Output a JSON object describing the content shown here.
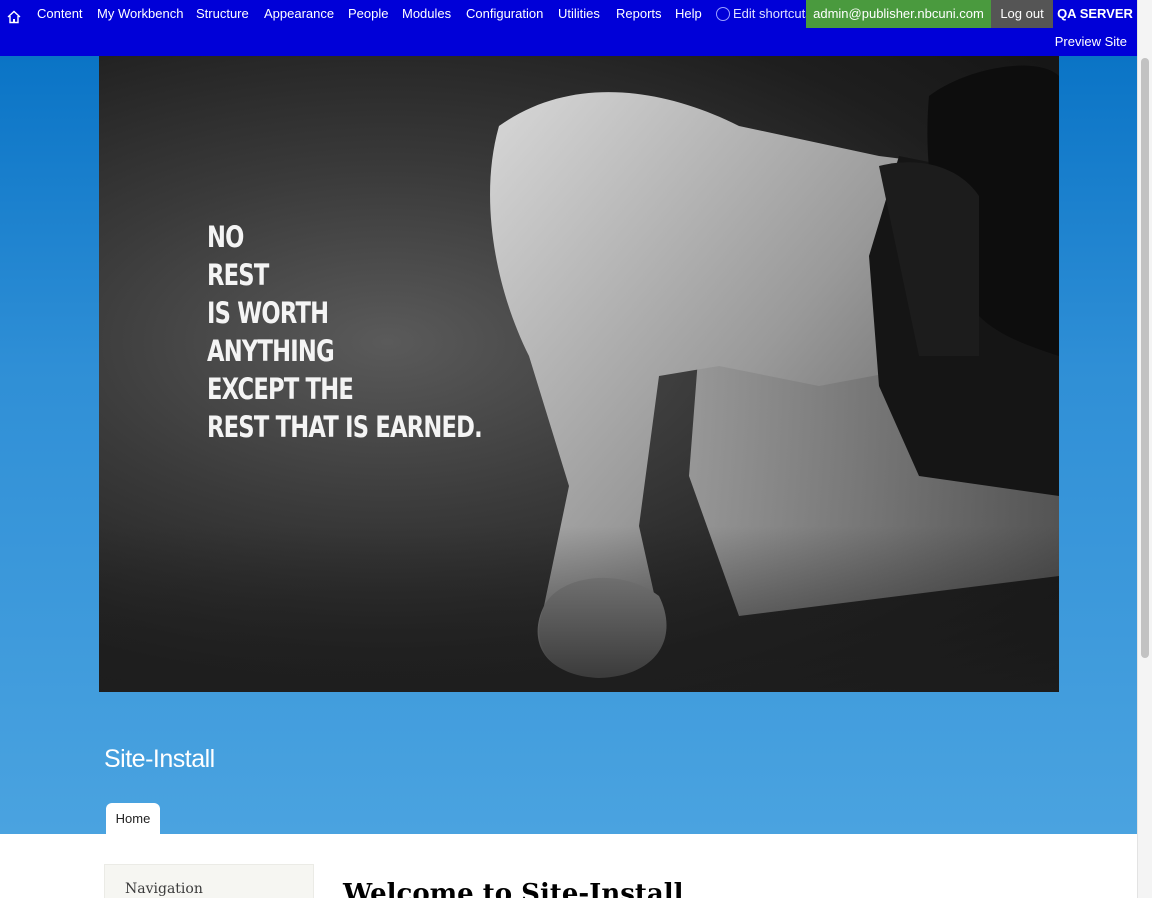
{
  "toolbar": {
    "menu": [
      {
        "label": "Content"
      },
      {
        "label": "My Workbench"
      },
      {
        "label": "Structure"
      },
      {
        "label": "Appearance"
      },
      {
        "label": "People"
      },
      {
        "label": "Modules"
      },
      {
        "label": "Configuration"
      },
      {
        "label": "Utilities"
      },
      {
        "label": "Reports"
      },
      {
        "label": "Help"
      }
    ],
    "shortcuts_label": "Edit shortcuts",
    "user": "admin@publisher.nbcuni.com",
    "logout": "Log out",
    "server": "QA SERVER",
    "preview": "Preview Site",
    "colors": {
      "bar": "#0000d8",
      "user": "#4a9a3e",
      "logout": "#555555"
    }
  },
  "hero": {
    "quote_lines": [
      "NO",
      "REST",
      "IS WORTH",
      "ANYTHING",
      "EXCEPT THE",
      "REST THAT IS EARNED."
    ]
  },
  "header": {
    "site_name": "Site-Install",
    "tab_home": "Home"
  },
  "sidebar": {
    "block_title": "Navigation"
  },
  "main": {
    "title": "Welcome to Site-Install"
  }
}
